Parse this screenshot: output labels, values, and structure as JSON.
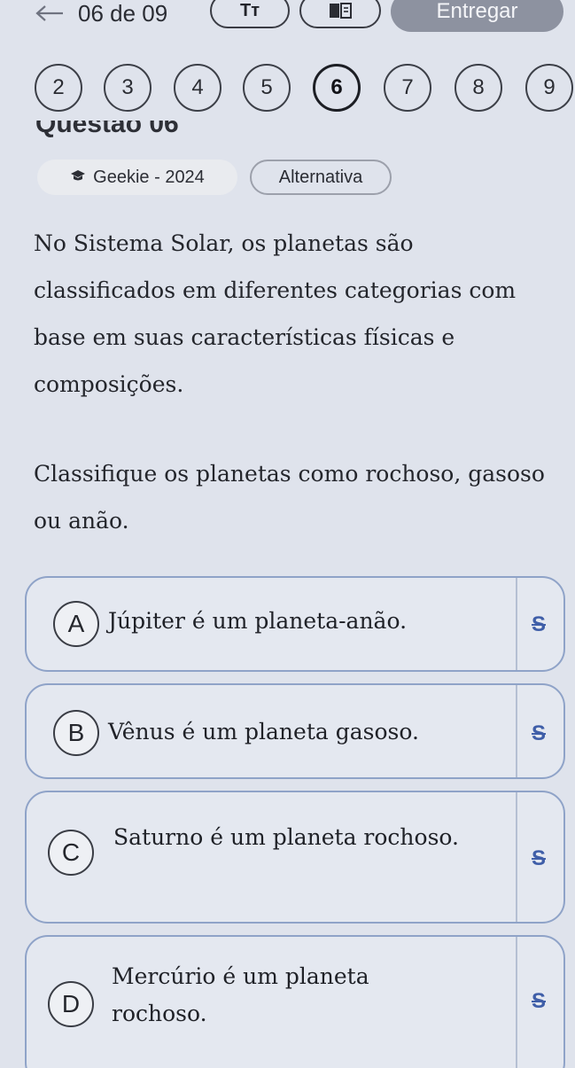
{
  "topbar": {
    "back_icon": "arrow-left-icon",
    "counter": "06 de 09",
    "font_button_label": "Tт",
    "book_icon": "book-icon",
    "submit_label": "Entregar"
  },
  "question_nav": {
    "items": [
      "2",
      "3",
      "4",
      "5",
      "6",
      "7",
      "8",
      "9"
    ],
    "current": "6"
  },
  "question": {
    "title": "Questão 06",
    "source_icon": "graduation-cap-icon",
    "source_label": "Geekie - 2024",
    "type_label": "Alternativa",
    "paragraph_1": "No Sistema Solar, os planetas são classificados em diferentes categorias com base em suas características físicas e composições.",
    "paragraph_2": "Classifique os planetas como rochoso, gasoso ou anão."
  },
  "options": [
    {
      "letter": "A",
      "text": "Júpiter é um planeta-anão.",
      "strike_icon": "strikethrough-icon"
    },
    {
      "letter": "B",
      "text": "Vênus é um planeta gasoso.",
      "strike_icon": "strikethrough-icon"
    },
    {
      "letter": "C",
      "text": "Saturno é um planeta rochoso.",
      "strike_icon": "strikethrough-icon"
    },
    {
      "letter": "D",
      "text": "Mercúrio é um planeta rochoso.",
      "strike_icon": "strikethrough-icon"
    }
  ],
  "colors": {
    "accent": "#3f5ea8",
    "option_border": "#8fa3c8",
    "submit_bg": "#8d92a0"
  }
}
